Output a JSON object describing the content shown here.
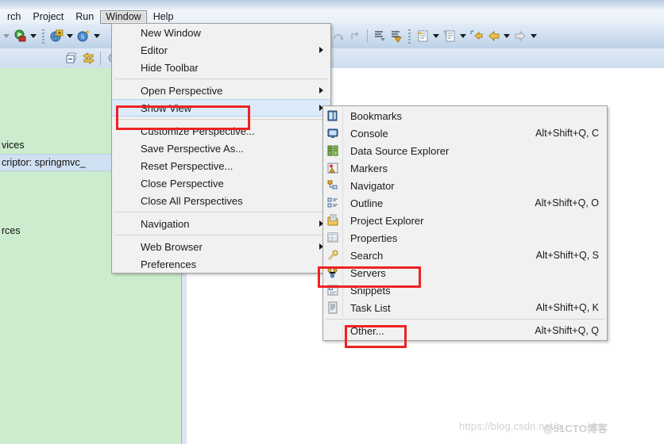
{
  "app": {
    "title_bar": "",
    "watermark_left": "https://blog.csdn.net/a",
    "watermark_right": "@51CTO博客"
  },
  "menubar": {
    "items": [
      {
        "label": "rch",
        "pressed": false
      },
      {
        "label": "Project",
        "pressed": false
      },
      {
        "label": "Run",
        "pressed": false
      },
      {
        "label": "Window",
        "pressed": true
      },
      {
        "label": "Help",
        "pressed": false
      }
    ]
  },
  "toolbar": {
    "icons": [
      "run-icon",
      "debug-icon",
      "web-new-icon",
      "spring-new-icon",
      "search-icon",
      "step-into-icon",
      "step-over-icon",
      "step-return-icon",
      "next-annotation-icon",
      "previous-annotation-icon",
      "last-edit-location-icon",
      "open-type-icon",
      "back-icon",
      "forward-icon"
    ],
    "second_row_icons": [
      "restore-icon",
      "link-with-editor-icon",
      "view-menu-icon"
    ]
  },
  "explorer": {
    "rows": [
      {
        "label": "vices",
        "selected": false
      },
      {
        "label": "criptor: springmvc_",
        "selected": true
      },
      {
        "label": "rces",
        "selected": false
      }
    ]
  },
  "window_menu": {
    "name": "Window",
    "items": [
      {
        "label": "New Window",
        "accel": "",
        "submenu": false,
        "hovered": false
      },
      {
        "label": "Editor",
        "accel": "",
        "submenu": true,
        "hovered": false
      },
      {
        "label": "Hide Toolbar",
        "accel": "",
        "submenu": false,
        "hovered": false
      },
      {
        "separator": true
      },
      {
        "label": "Open Perspective",
        "accel": "",
        "submenu": true,
        "hovered": false
      },
      {
        "label": "Show View",
        "accel": "",
        "submenu": true,
        "hovered": true
      },
      {
        "separator": true
      },
      {
        "label": "Customize Perspective...",
        "accel": "",
        "submenu": false,
        "hovered": false
      },
      {
        "label": "Save Perspective As...",
        "accel": "",
        "submenu": false,
        "hovered": false
      },
      {
        "label": "Reset Perspective...",
        "accel": "",
        "submenu": false,
        "hovered": false
      },
      {
        "label": "Close Perspective",
        "accel": "",
        "submenu": false,
        "hovered": false
      },
      {
        "label": "Close All Perspectives",
        "accel": "",
        "submenu": false,
        "hovered": false
      },
      {
        "separator": true
      },
      {
        "label": "Navigation",
        "accel": "",
        "submenu": true,
        "hovered": false
      },
      {
        "separator": true
      },
      {
        "label": "Web Browser",
        "accel": "",
        "submenu": true,
        "hovered": false
      },
      {
        "label": "Preferences",
        "accel": "",
        "submenu": false,
        "hovered": false
      }
    ]
  },
  "show_view_menu": {
    "name": "Show View",
    "items": [
      {
        "label": "Bookmarks",
        "accel": "",
        "icon": "bookmarks-icon"
      },
      {
        "label": "Console",
        "accel": "Alt+Shift+Q, C",
        "icon": "console-icon"
      },
      {
        "label": "Data Source Explorer",
        "accel": "",
        "icon": "data-source-explorer-icon"
      },
      {
        "label": "Markers",
        "accel": "",
        "icon": "markers-icon"
      },
      {
        "label": "Navigator",
        "accel": "",
        "icon": "navigator-icon"
      },
      {
        "label": "Outline",
        "accel": "Alt+Shift+Q, O",
        "icon": "outline-icon"
      },
      {
        "label": "Project Explorer",
        "accel": "",
        "icon": "project-explorer-icon"
      },
      {
        "label": "Properties",
        "accel": "",
        "icon": "properties-icon"
      },
      {
        "label": "Search",
        "accel": "Alt+Shift+Q, S",
        "icon": "search-icon"
      },
      {
        "label": "Servers",
        "accel": "",
        "icon": "servers-icon"
      },
      {
        "label": "Snippets",
        "accel": "",
        "icon": "snippets-icon"
      },
      {
        "label": "Task List",
        "accel": "Alt+Shift+Q, K",
        "icon": "task-list-icon"
      },
      {
        "separator": true
      },
      {
        "label": "Other...",
        "accel": "Alt+Shift+Q, Q",
        "icon": ""
      }
    ]
  },
  "annotations": {
    "highlight_color": "#ee2222",
    "boxes": [
      {
        "target": "Show View"
      },
      {
        "target": "Servers"
      },
      {
        "target": "Other..."
      }
    ]
  }
}
